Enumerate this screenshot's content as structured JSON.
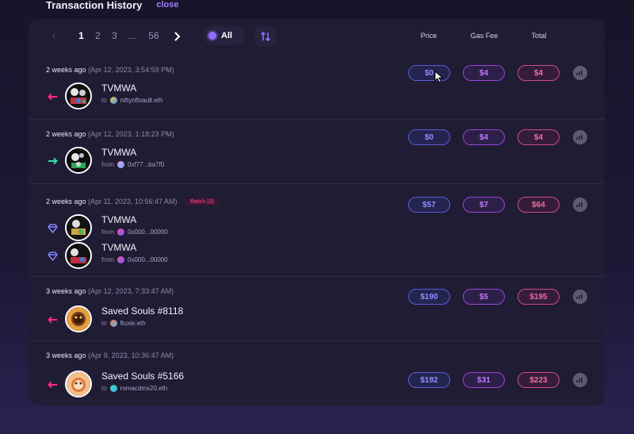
{
  "header": {
    "title": "Transaction History",
    "close_label": "close"
  },
  "pagination": {
    "pages": [
      "1",
      "2",
      "3",
      "...",
      "56"
    ],
    "active": "1"
  },
  "filter": {
    "label": "All"
  },
  "columns": {
    "price": "Price",
    "gas": "Gas Fee",
    "total": "Total"
  },
  "colors": {
    "price": "#8f91ff",
    "gas": "#c07bff",
    "total": "#f06ca2",
    "sent": "#ff2d7a",
    "received": "#2fe0a4",
    "mint": "#7f84ff"
  },
  "transactions": [
    {
      "ago": "2 weeks ago",
      "date": "(Apr 12, 2023, 3:54:59 PM)",
      "batch": "",
      "items": [
        {
          "direction": "sent",
          "name": "TVMWA",
          "prefix": "to",
          "address": "niftynftvault.eth"
        }
      ],
      "price": "$0",
      "gas": "$4",
      "total": "$4"
    },
    {
      "ago": "2 weeks ago",
      "date": "(Apr 12, 2023, 1:18:23 PM)",
      "batch": "",
      "items": [
        {
          "direction": "received",
          "name": "TVMWA",
          "prefix": "from",
          "address": "0xf77...ba7f0"
        }
      ],
      "price": "$0",
      "gas": "$4",
      "total": "$4"
    },
    {
      "ago": "2 weeks ago",
      "date": "(Apr 11, 2023, 10:56:47 AM)",
      "batch": "Batch (2)",
      "items": [
        {
          "direction": "mint",
          "name": "TVMWA",
          "prefix": "from",
          "address": "0x000...00000"
        },
        {
          "direction": "mint",
          "name": "TVMWA",
          "prefix": "from",
          "address": "0x000...00000"
        }
      ],
      "price": "$57",
      "gas": "$7",
      "total": "$64"
    },
    {
      "ago": "3 weeks ago",
      "date": "(Apr 12, 2023, 7:33:47 AM)",
      "batch": "",
      "items": [
        {
          "direction": "sent",
          "name": "Saved Souls #8118",
          "prefix": "to",
          "address": "fluxie.eth"
        }
      ],
      "price": "$190",
      "gas": "$5",
      "total": "$195"
    },
    {
      "ago": "3 weeks ago",
      "date": "(Apr 9, 2023, 10:36:47 AM)",
      "batch": "",
      "items": [
        {
          "direction": "sent",
          "name": "Saved Souls #5166",
          "prefix": "to",
          "address": "romacdmx20.eth"
        }
      ],
      "price": "$192",
      "gas": "$31",
      "total": "$223"
    }
  ]
}
